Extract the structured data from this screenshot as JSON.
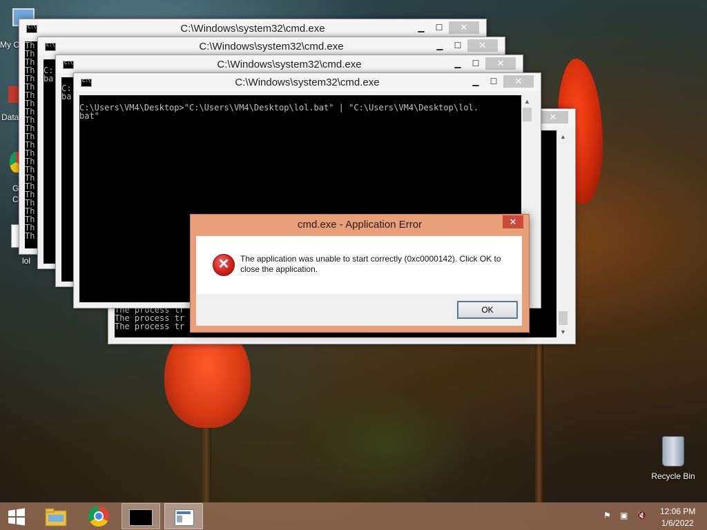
{
  "desktop": {
    "icons": [
      {
        "label": "My C"
      },
      {
        "label": "Data"
      },
      {
        "label": "G"
      },
      {
        "label": "C"
      },
      {
        "label": "lol"
      },
      {
        "label": "Recycle Bin"
      }
    ]
  },
  "windows": [
    {
      "title": "C:\\Windows\\system32\\cmd.exe",
      "minimize": "▁",
      "maximize": "☐",
      "close": "✕"
    },
    {
      "title": "C:\\Windows\\system32\\cmd.exe",
      "minimize": "▁",
      "maximize": "☐",
      "close": "✕"
    },
    {
      "title": "C:\\Windows\\system32\\cmd.exe",
      "minimize": "▁",
      "maximize": "☐",
      "close": "✕"
    },
    {
      "title": "C:\\Windows\\system32\\cmd.exe",
      "minimize": "▁",
      "maximize": "☐",
      "close": "✕"
    }
  ],
  "console": {
    "back_lines": "Th\nTh\nTh\nTh\nTh\nTh\nTh\nTh\nTh\nTh\nTh\nTh\nTh\nTh\nTh\nTh\nTh\nTh\nTh\nTh\nTh\nTh\nTh\nTh",
    "win2_text": "C:\nba",
    "win3_text": "C:\nba",
    "front_text": "C:\\Users\\VM4\\Desktop>\"C:\\Users\\VM4\\Desktop\\lol.bat\" | \"C:\\Users\\VM4\\Desktop\\lol.\nbat\"",
    "bottom_text": "The process tr\nThe process tr\nThe process tr"
  },
  "dialog": {
    "title": "cmd.exe - Application Error",
    "close": "✕",
    "message": "The application was unable to start correctly (0xc0000142). Click OK to close the application.",
    "ok_label": "OK",
    "icon": "error-icon"
  },
  "taskbar": {
    "time": "12:06 PM",
    "date": "1/6/2022",
    "pinned": [
      "start-icon",
      "file-explorer-icon",
      "chrome-icon",
      "cmd-icon",
      "window-icon"
    ]
  }
}
